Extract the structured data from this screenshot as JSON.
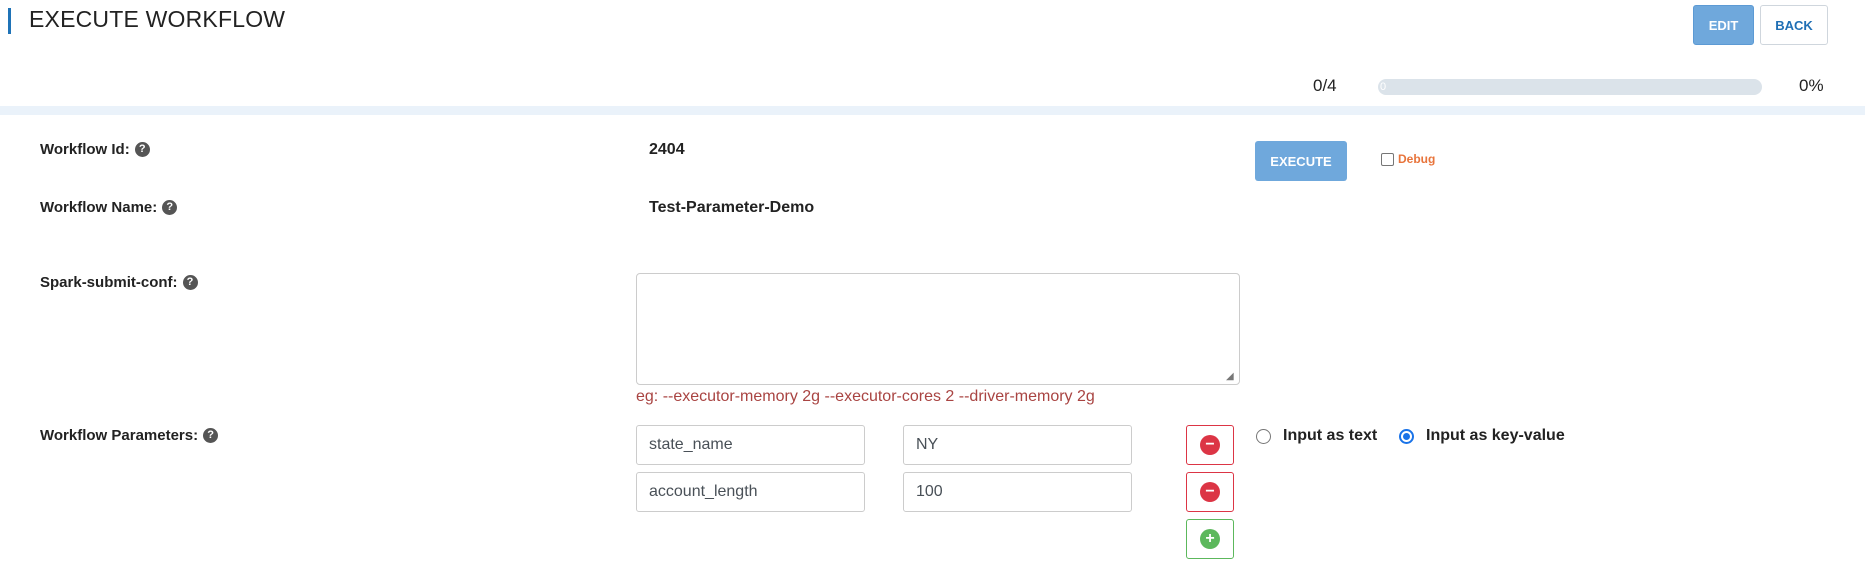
{
  "header": {
    "title": "EXECUTE WORKFLOW",
    "edit_label": "EDIT",
    "back_label": "BACK"
  },
  "progress": {
    "count": "0/4",
    "bar_text": "0",
    "percent_text": "0%",
    "fraction": 0
  },
  "form": {
    "workflow_id_label": "Workflow Id:",
    "workflow_id_value": "2404",
    "workflow_name_label": "Workflow Name:",
    "workflow_name_value": "Test-Parameter-Demo",
    "spark_conf_label": "Spark-submit-conf:",
    "spark_conf_value": "",
    "spark_conf_hint": "eg: --executor-memory 2g --executor-cores 2 --driver-memory 2g",
    "workflow_params_label": "Workflow Parameters:",
    "params": [
      {
        "key": "state_name",
        "value": "NY"
      },
      {
        "key": "account_length",
        "value": "100"
      }
    ],
    "input_mode_text_label": "Input as text",
    "input_mode_kv_label": "Input as key-value",
    "input_mode_selected": "key-value"
  },
  "actions": {
    "execute_label": "EXECUTE",
    "debug_label": "Debug",
    "debug_checked": false
  },
  "icons": {
    "help": "question-circle-icon",
    "remove": "minus-circle-icon",
    "add": "plus-circle-icon"
  },
  "colors": {
    "accent": "#1f73b7",
    "primary_button": "#6fa8dc",
    "danger": "#dc3545",
    "success": "#5cb85c",
    "hint": "#a94442",
    "debug": "#e8743b"
  }
}
